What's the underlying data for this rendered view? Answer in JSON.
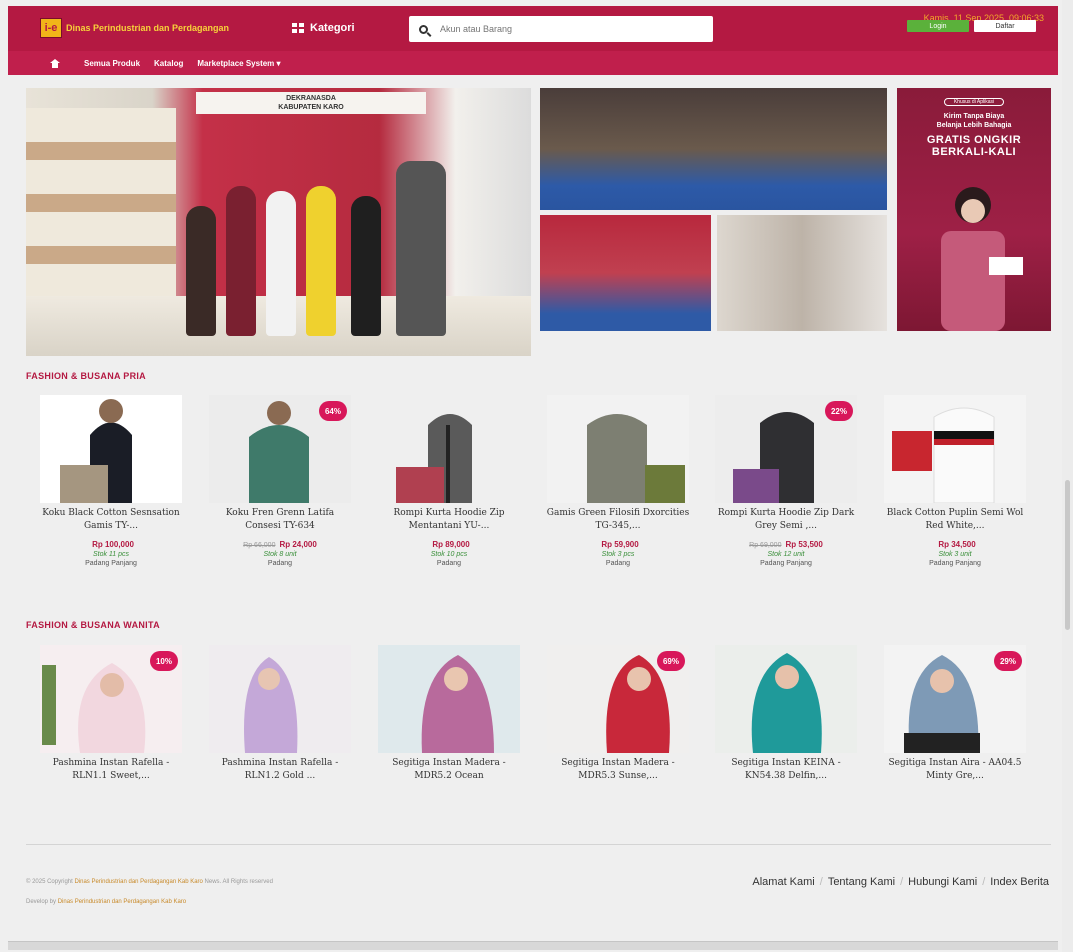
{
  "header": {
    "site_name": "Dinas Perindustrian dan Perdagangan",
    "logo_badge": "i-e",
    "kategori_label": "Kategori",
    "search_placeholder": "Akun atau Barang",
    "datetime": "Kamis, 11 Sep 2025, 09:06:33",
    "login_label": "Login",
    "daftar_label": "Daftar"
  },
  "nav": {
    "items": [
      "Semua Produk",
      "Katalog",
      "Marketplace System ▾"
    ]
  },
  "banners": {
    "main_sign": "DEKRANASDA\nKABUPATEN KARO",
    "promo_tag": "Khusus di Aplikasi",
    "promo_small": "Kirim Tanpa Biaya\nBelanja Lebih Bahagia",
    "promo_big": "GRATIS ONGKIR\nBERKALI-KALI"
  },
  "sections": [
    {
      "title": "FASHION & BUSANA PRIA",
      "products": [
        {
          "name": "Koku Black Cotton Sesnsation Gamis TY-...",
          "price": "Rp 100,000",
          "old_price": "",
          "discount": "",
          "stock": "Stok 11 pcs",
          "location": "Padang Panjang"
        },
        {
          "name": "Koku Fren Grenn Latifa Consesi TY-634",
          "price": "Rp 24,000",
          "old_price": "Rp 66,000",
          "discount": "64%",
          "stock": "Stok 8 unit",
          "location": "Padang"
        },
        {
          "name": "Rompi Kurta Hoodie Zip Mentantani YU-...",
          "price": "Rp 89,000",
          "old_price": "",
          "discount": "",
          "stock": "Stok 10 pcs",
          "location": "Padang"
        },
        {
          "name": "Gamis Green Filosifi Dxorcities TG-345,...",
          "price": "Rp 59,900",
          "old_price": "",
          "discount": "",
          "stock": "Stok 3 pcs",
          "location": "Padang"
        },
        {
          "name": "Rompi Kurta Hoodie Zip Dark Grey Semi ,...",
          "price": "Rp 53,500",
          "old_price": "Rp 69,000",
          "discount": "22%",
          "stock": "Stok 12 unit",
          "location": "Padang Panjang"
        },
        {
          "name": "Black Cotton Puplin Semi Wol Red White,...",
          "price": "Rp 34,500",
          "old_price": "",
          "discount": "",
          "stock": "Stok 3 unit",
          "location": "Padang Panjang"
        }
      ]
    },
    {
      "title": "FASHION & BUSANA WANITA",
      "products": [
        {
          "name": "Pashmina Instan Rafella - RLN1.1 Sweet,...",
          "discount": "10%"
        },
        {
          "name": "Pashmina Instan Rafella - RLN1.2 Gold ...",
          "discount": ""
        },
        {
          "name": "Segitiga Instan Madera - MDR5.2 Ocean",
          "discount": ""
        },
        {
          "name": "Segitiga Instan Madera - MDR5.3 Sunse,...",
          "discount": "69%"
        },
        {
          "name": "Segitiga Instan KEINA - KN54.38 Delfin,...",
          "discount": ""
        },
        {
          "name": "Segitiga Instan Aira - AA04.5 Minty Gre,...",
          "discount": "29%"
        }
      ]
    }
  ],
  "footer": {
    "copyright_prefix": "© 2025 Copyright",
    "copyright_org": "Dinas Perindustrian dan Perdagangan Kab Karo",
    "copyright_suffix": "News. All Rights reserved",
    "powered_prefix": "Develop by",
    "powered_org": "Dinas Perindustrian dan Perdagangan Kab Karo",
    "links": [
      "Alamat Kami",
      "Tentang Kami",
      "Hubungi Kami",
      "Index Berita"
    ]
  },
  "colors": {
    "primary": "#b41942",
    "nav": "#c01f4c",
    "discount_badge": "#d8175a",
    "stock": "#3a8f3a",
    "login": "#5bb13b"
  }
}
